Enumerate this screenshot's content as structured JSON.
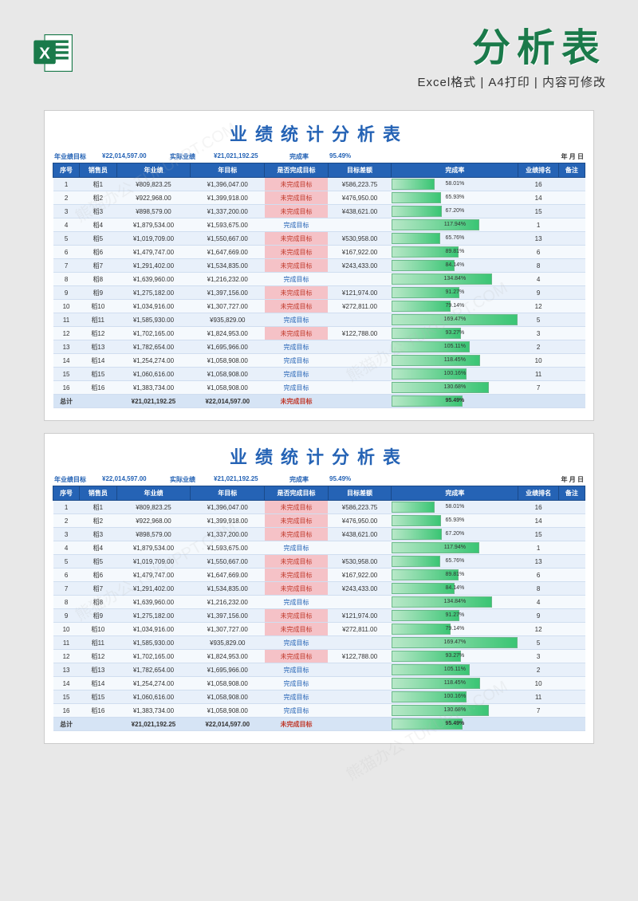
{
  "header": {
    "main_title": "分析表",
    "subtitle": "Excel格式 | A4打印 | 内容可修改"
  },
  "sheet": {
    "title": "业绩统计分析表",
    "summary": {
      "l1": "年业绩目标",
      "v1": "¥22,014,597.00",
      "l2": "实际业绩",
      "v2": "¥21,021,192.25",
      "l3": "完成率",
      "v3": "95.49%",
      "date": "年  月  日"
    },
    "columns": [
      "序号",
      "销售员",
      "年业绩",
      "年目标",
      "是否完成目标",
      "目标差额",
      "完成率",
      "业绩排名",
      "备注"
    ],
    "status_fail": "未完成目标",
    "status_pass": "完成目标",
    "rows": [
      {
        "idx": 1,
        "name": "稻1",
        "actual": "¥809,823.25",
        "target": "¥1,396,047.00",
        "done": false,
        "diff": "¥586,223.75",
        "pct": 58.01,
        "rank": 16
      },
      {
        "idx": 2,
        "name": "稻2",
        "actual": "¥922,968.00",
        "target": "¥1,399,918.00",
        "done": false,
        "diff": "¥476,950.00",
        "pct": 65.93,
        "rank": 14
      },
      {
        "idx": 3,
        "name": "稻3",
        "actual": "¥898,579.00",
        "target": "¥1,337,200.00",
        "done": false,
        "diff": "¥438,621.00",
        "pct": 67.2,
        "rank": 15
      },
      {
        "idx": 4,
        "name": "稻4",
        "actual": "¥1,879,534.00",
        "target": "¥1,593,675.00",
        "done": true,
        "diff": "",
        "pct": 117.94,
        "rank": 1
      },
      {
        "idx": 5,
        "name": "稻5",
        "actual": "¥1,019,709.00",
        "target": "¥1,550,667.00",
        "done": false,
        "diff": "¥530,958.00",
        "pct": 65.76,
        "rank": 13
      },
      {
        "idx": 6,
        "name": "稻6",
        "actual": "¥1,479,747.00",
        "target": "¥1,647,669.00",
        "done": false,
        "diff": "¥167,922.00",
        "pct": 89.81,
        "rank": 6
      },
      {
        "idx": 7,
        "name": "稻7",
        "actual": "¥1,291,402.00",
        "target": "¥1,534,835.00",
        "done": false,
        "diff": "¥243,433.00",
        "pct": 84.14,
        "rank": 8
      },
      {
        "idx": 8,
        "name": "稻8",
        "actual": "¥1,639,960.00",
        "target": "¥1,216,232.00",
        "done": true,
        "diff": "",
        "pct": 134.84,
        "rank": 4
      },
      {
        "idx": 9,
        "name": "稻9",
        "actual": "¥1,275,182.00",
        "target": "¥1,397,156.00",
        "done": false,
        "diff": "¥121,974.00",
        "pct": 91.27,
        "rank": 9
      },
      {
        "idx": 10,
        "name": "稻10",
        "actual": "¥1,034,916.00",
        "target": "¥1,307,727.00",
        "done": false,
        "diff": "¥272,811.00",
        "pct": 79.14,
        "rank": 12
      },
      {
        "idx": 11,
        "name": "稻11",
        "actual": "¥1,585,930.00",
        "target": "¥935,829.00",
        "done": true,
        "diff": "",
        "pct": 169.47,
        "rank": 5
      },
      {
        "idx": 12,
        "name": "稻12",
        "actual": "¥1,702,165.00",
        "target": "¥1,824,953.00",
        "done": false,
        "diff": "¥122,788.00",
        "pct": 93.27,
        "rank": 3
      },
      {
        "idx": 13,
        "name": "稻13",
        "actual": "¥1,782,654.00",
        "target": "¥1,695,966.00",
        "done": true,
        "diff": "",
        "pct": 105.11,
        "rank": 2
      },
      {
        "idx": 14,
        "name": "稻14",
        "actual": "¥1,254,274.00",
        "target": "¥1,058,908.00",
        "done": true,
        "diff": "",
        "pct": 118.45,
        "rank": 10
      },
      {
        "idx": 15,
        "name": "稻15",
        "actual": "¥1,060,616.00",
        "target": "¥1,058,908.00",
        "done": true,
        "diff": "",
        "pct": 100.16,
        "rank": 11
      },
      {
        "idx": 16,
        "name": "稻16",
        "actual": "¥1,383,734.00",
        "target": "¥1,058,908.00",
        "done": true,
        "diff": "",
        "pct": 130.68,
        "rank": 7
      }
    ],
    "total": {
      "label": "总计",
      "actual": "¥21,021,192.25",
      "target": "¥22,014,597.00",
      "done": false,
      "diff": "",
      "pct": 95.49,
      "rank": ""
    }
  }
}
